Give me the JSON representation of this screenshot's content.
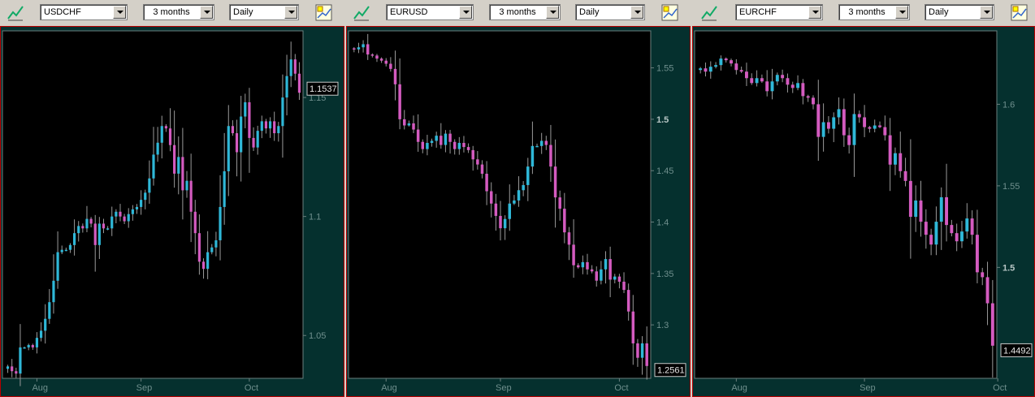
{
  "colors": {
    "up": "#2fb8d8",
    "down": "#d45bc0",
    "wick": "#9a9a9a",
    "plot_bg": "#000000",
    "frame_bg": "#05302e",
    "axis_text": "#6f8f8d"
  },
  "panels": [
    {
      "symbol": "USDCHF",
      "range": "3 months",
      "interval": "Daily",
      "icons": [
        "trend-tool-icon",
        "chart-settings-icon"
      ]
    },
    {
      "symbol": "EURUSD",
      "range": "3 months",
      "interval": "Daily",
      "icons": [
        "trend-tool-icon",
        "chart-settings-icon"
      ]
    },
    {
      "symbol": "EURCHF",
      "range": "3 months",
      "interval": "Daily",
      "icons": [
        "trend-tool-icon",
        "chart-settings-icon"
      ]
    }
  ],
  "chart_data": [
    {
      "type": "candlestick",
      "symbol": "USDCHF",
      "ylim": [
        1.032,
        1.178
      ],
      "yticks": [
        "1.05",
        "1.1",
        "1.15"
      ],
      "bold_tick": "",
      "xticks": [
        "Aug",
        "Sep",
        "Oct"
      ],
      "x_tick_index": [
        7,
        32,
        58
      ],
      "last_price": "1.1537",
      "close": [
        1.037,
        1.035,
        1.034,
        1.045,
        1.045,
        1.046,
        1.045,
        1.049,
        1.052,
        1.057,
        1.064,
        1.073,
        1.085,
        1.086,
        1.086,
        1.088,
        1.093,
        1.096,
        1.095,
        1.099,
        1.097,
        1.088,
        1.097,
        1.095,
        1.095,
        1.1,
        1.102,
        1.1,
        1.098,
        1.101,
        1.103,
        1.104,
        1.107,
        1.11,
        1.116,
        1.126,
        1.131,
        1.138,
        1.137,
        1.13,
        1.118,
        1.125,
        1.111,
        1.115,
        1.102,
        1.093,
        1.081,
        1.078,
        1.085,
        1.087,
        1.09,
        1.104,
        1.119,
        1.138,
        1.135,
        1.127,
        1.142,
        1.148,
        1.133,
        1.129,
        1.136,
        1.14,
        1.137,
        1.14,
        1.135,
        1.138,
        1.15,
        1.159,
        1.166,
        1.16,
        1.152
      ]
    },
    {
      "type": "candlestick",
      "symbol": "EURUSD",
      "ylim": [
        1.248,
        1.586
      ],
      "yticks": [
        "1.3",
        "1.35",
        "1.4",
        "1.45",
        "1.55"
      ],
      "bold_tick": "1.5",
      "xticks": [
        "Aug",
        "Sep",
        "Oct"
      ],
      "x_tick_index": [
        7,
        32,
        58
      ],
      "last_price": "1.2561",
      "close": [
        1.568,
        1.57,
        1.573,
        1.563,
        1.562,
        1.559,
        1.557,
        1.554,
        1.549,
        1.534,
        1.5,
        1.494,
        1.496,
        1.49,
        1.478,
        1.471,
        1.477,
        1.479,
        1.484,
        1.475,
        1.486,
        1.478,
        1.471,
        1.477,
        1.473,
        1.47,
        1.461,
        1.456,
        1.447,
        1.43,
        1.418,
        1.406,
        1.394,
        1.403,
        1.418,
        1.421,
        1.431,
        1.436,
        1.454,
        1.474,
        1.474,
        1.479,
        1.475,
        1.454,
        1.424,
        1.413,
        1.39,
        1.378,
        1.358,
        1.356,
        1.361,
        1.354,
        1.352,
        1.343,
        1.354,
        1.364,
        1.344,
        1.347,
        1.342,
        1.334,
        1.313,
        1.282,
        1.268,
        1.282,
        1.26
      ]
    },
    {
      "type": "candlestick",
      "symbol": "EURCHF",
      "ylim": [
        1.432,
        1.645
      ],
      "yticks": [
        "1.55",
        "1.6"
      ],
      "bold_tick": "1.5",
      "xticks": [
        "Aug",
        "Sep",
        "Oct"
      ],
      "x_tick_index": [
        7,
        32,
        58
      ],
      "last_price": "1.4492",
      "close": [
        1.622,
        1.62,
        1.623,
        1.624,
        1.628,
        1.627,
        1.625,
        1.621,
        1.62,
        1.616,
        1.613,
        1.616,
        1.614,
        1.608,
        1.614,
        1.618,
        1.616,
        1.612,
        1.61,
        1.613,
        1.605,
        1.604,
        1.6,
        1.58,
        1.589,
        1.585,
        1.592,
        1.597,
        1.581,
        1.575,
        1.594,
        1.592,
        1.586,
        1.585,
        1.587,
        1.586,
        1.581,
        1.563,
        1.57,
        1.559,
        1.553,
        1.531,
        1.541,
        1.528,
        1.52,
        1.514,
        1.528,
        1.543,
        1.526,
        1.521,
        1.516,
        1.522,
        1.53,
        1.52,
        1.497,
        1.494,
        1.478,
        1.452
      ]
    }
  ]
}
